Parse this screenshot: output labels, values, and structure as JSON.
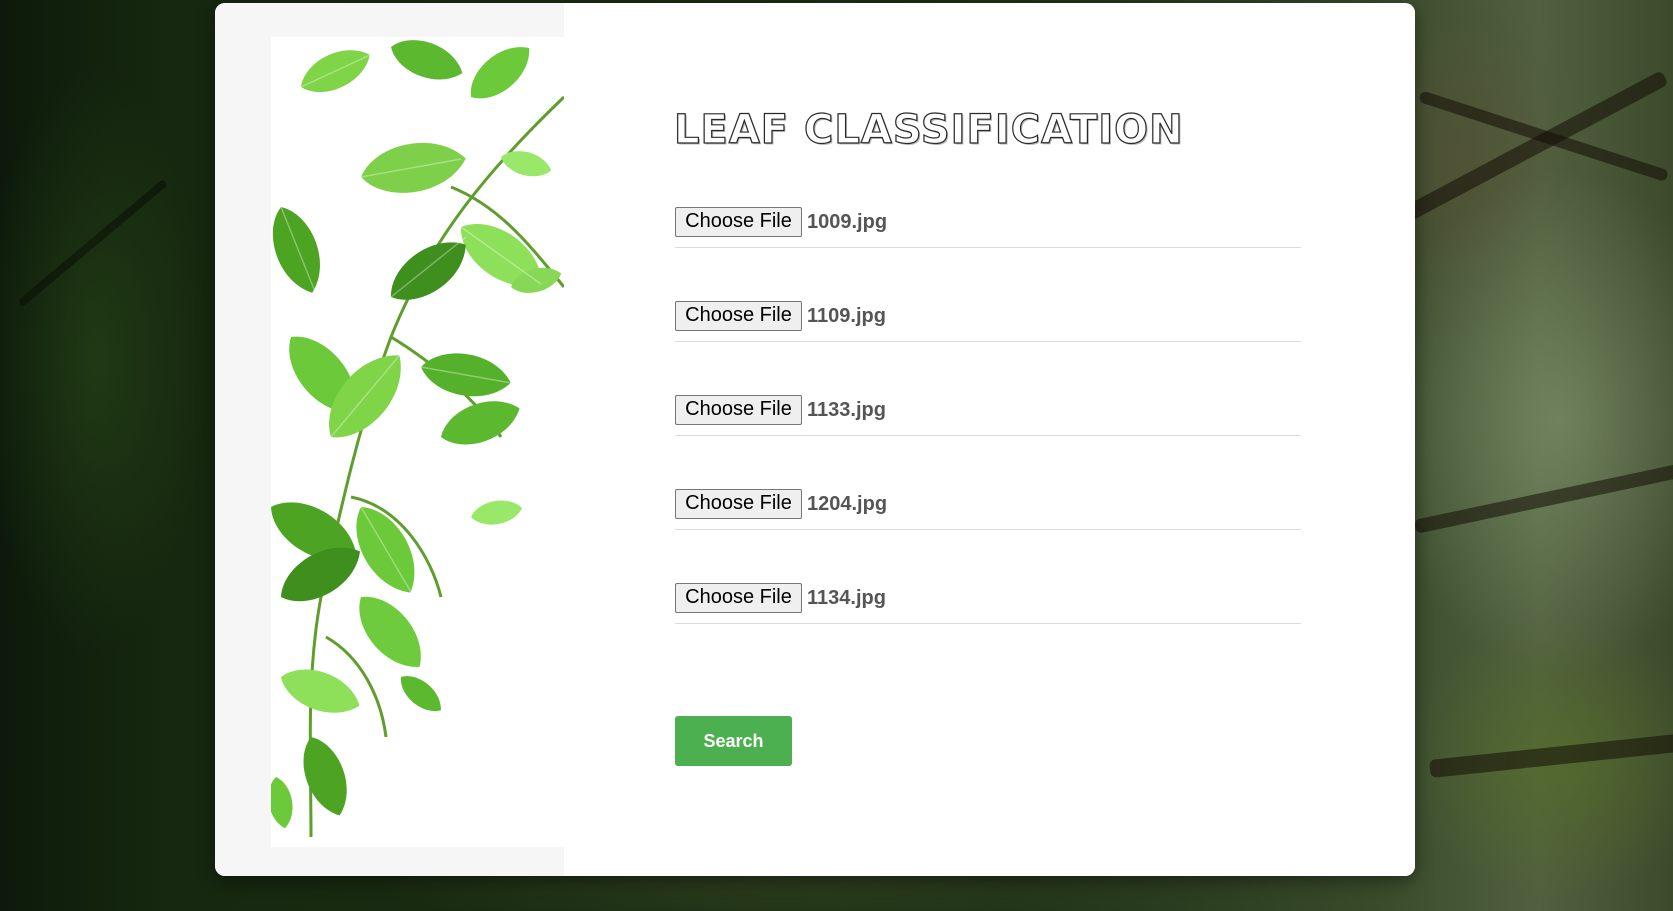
{
  "page": {
    "title": "LEAF CLASSIFICATION"
  },
  "left_panel": {
    "image": "green-leaves-image"
  },
  "upload": {
    "rows": [
      {
        "button_label": "Choose File",
        "file_name": "1009.jpg"
      },
      {
        "button_label": "Choose File",
        "file_name": "1109.jpg"
      },
      {
        "button_label": "Choose File",
        "file_name": "1133.jpg"
      },
      {
        "button_label": "Choose File",
        "file_name": "1204.jpg"
      },
      {
        "button_label": "Choose File",
        "file_name": "1134.jpg"
      }
    ]
  },
  "actions": {
    "search_label": "Search"
  },
  "colors": {
    "accent": "#4caf50",
    "leaf_green": "#6cc93a",
    "leaf_dark": "#3f8f1f"
  }
}
